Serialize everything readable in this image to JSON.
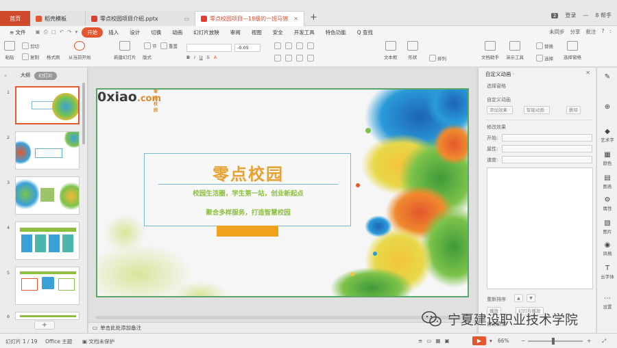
{
  "tabs": {
    "home": "首页",
    "t1": "稻壳模板",
    "t2": "零点校园项目介绍.pptx",
    "t3": "零点校园项目—18级的一班马锦",
    "new_tab": "+"
  },
  "window": {
    "badge": "2",
    "user_label": "登录",
    "right_label": "8 帮手"
  },
  "menu": {
    "file": "≡ 文件",
    "items": [
      "开始",
      "插入",
      "设计",
      "切换",
      "动画",
      "幻灯片放映",
      "审阅",
      "视图",
      "安全",
      "开发工具",
      "特色功能",
      "Q 查找"
    ],
    "right": [
      "未同步",
      "分享",
      "批注",
      "?",
      ":"
    ]
  },
  "ribbon": {
    "paste": "粘贴",
    "cut": "剪切",
    "copy": "复制",
    "format_painter": "格式刷",
    "start_from_current": "从当前开始",
    "new_slide": "新建幻灯片",
    "layout": "版式",
    "section": "节",
    "reset": "重置",
    "font_size": "-0.05",
    "textbox": "文本框",
    "shapes": "形状",
    "arrange": "排列",
    "doc_helper": "文档助手",
    "present_tool": "演示工具",
    "replace": "替换",
    "select_pane": "选择窗格",
    "select": "选择"
  },
  "left_panel": {
    "tab_outline": "大纲",
    "tab_slides": "幻灯片",
    "slide_numbers": [
      "1",
      "2",
      "3",
      "4",
      "5",
      "6"
    ],
    "add": "+"
  },
  "slide": {
    "logo_main": "0xiao",
    "logo_com": ".com",
    "logo_small": "零点校园",
    "title": "零点校园",
    "subtitle1": "校园生活圈，学生第一站，创业新起点",
    "subtitle2": "聚合多样服务，打造智慧校园"
  },
  "notes": {
    "placeholder": "单击此处添加备注"
  },
  "right_panel": {
    "title": "自定义动画 ·",
    "select_pane": "选择窗格",
    "custom_anim": "自定义动画",
    "add_effect": "添加效果 ·",
    "smart_anim": "智能动画 ·",
    "delete": "删除",
    "modify": "修改效果",
    "start": "开始:",
    "property": "属性:",
    "speed": "速度:",
    "reorder": "重新排序",
    "play": "播放",
    "slideshow": "幻灯片播放",
    "autopreview": "自动预览"
  },
  "siderail": [
    {
      "icon": "✎",
      "label": ""
    },
    {
      "icon": "⊕",
      "label": ""
    },
    {
      "icon": "◆",
      "label": "艺术字"
    },
    {
      "icon": "▦",
      "label": "颜色"
    },
    {
      "icon": "▤",
      "label": "图表"
    },
    {
      "icon": "⚙",
      "label": "属性"
    },
    {
      "icon": "▧",
      "label": "图片"
    },
    {
      "icon": "◉",
      "label": "风格"
    },
    {
      "icon": "T",
      "label": "云字体"
    },
    {
      "icon": "⋯",
      "label": "设置"
    }
  ],
  "status": {
    "slide_count": "幻灯片 1 / 19",
    "theme": "Office 主题",
    "protect": "文档未保护",
    "zoom": "66%",
    "minus": "−",
    "plus": "+",
    "fit": "⤢"
  },
  "watermark": {
    "text": "宁夏建设职业技术学院"
  },
  "colors": {
    "accent": "#e4572e",
    "title_orange": "#e8a030",
    "subtitle_green": "#8cbf3f",
    "slide_border": "#5aa56a",
    "orange_bar": "#f0a21c"
  }
}
